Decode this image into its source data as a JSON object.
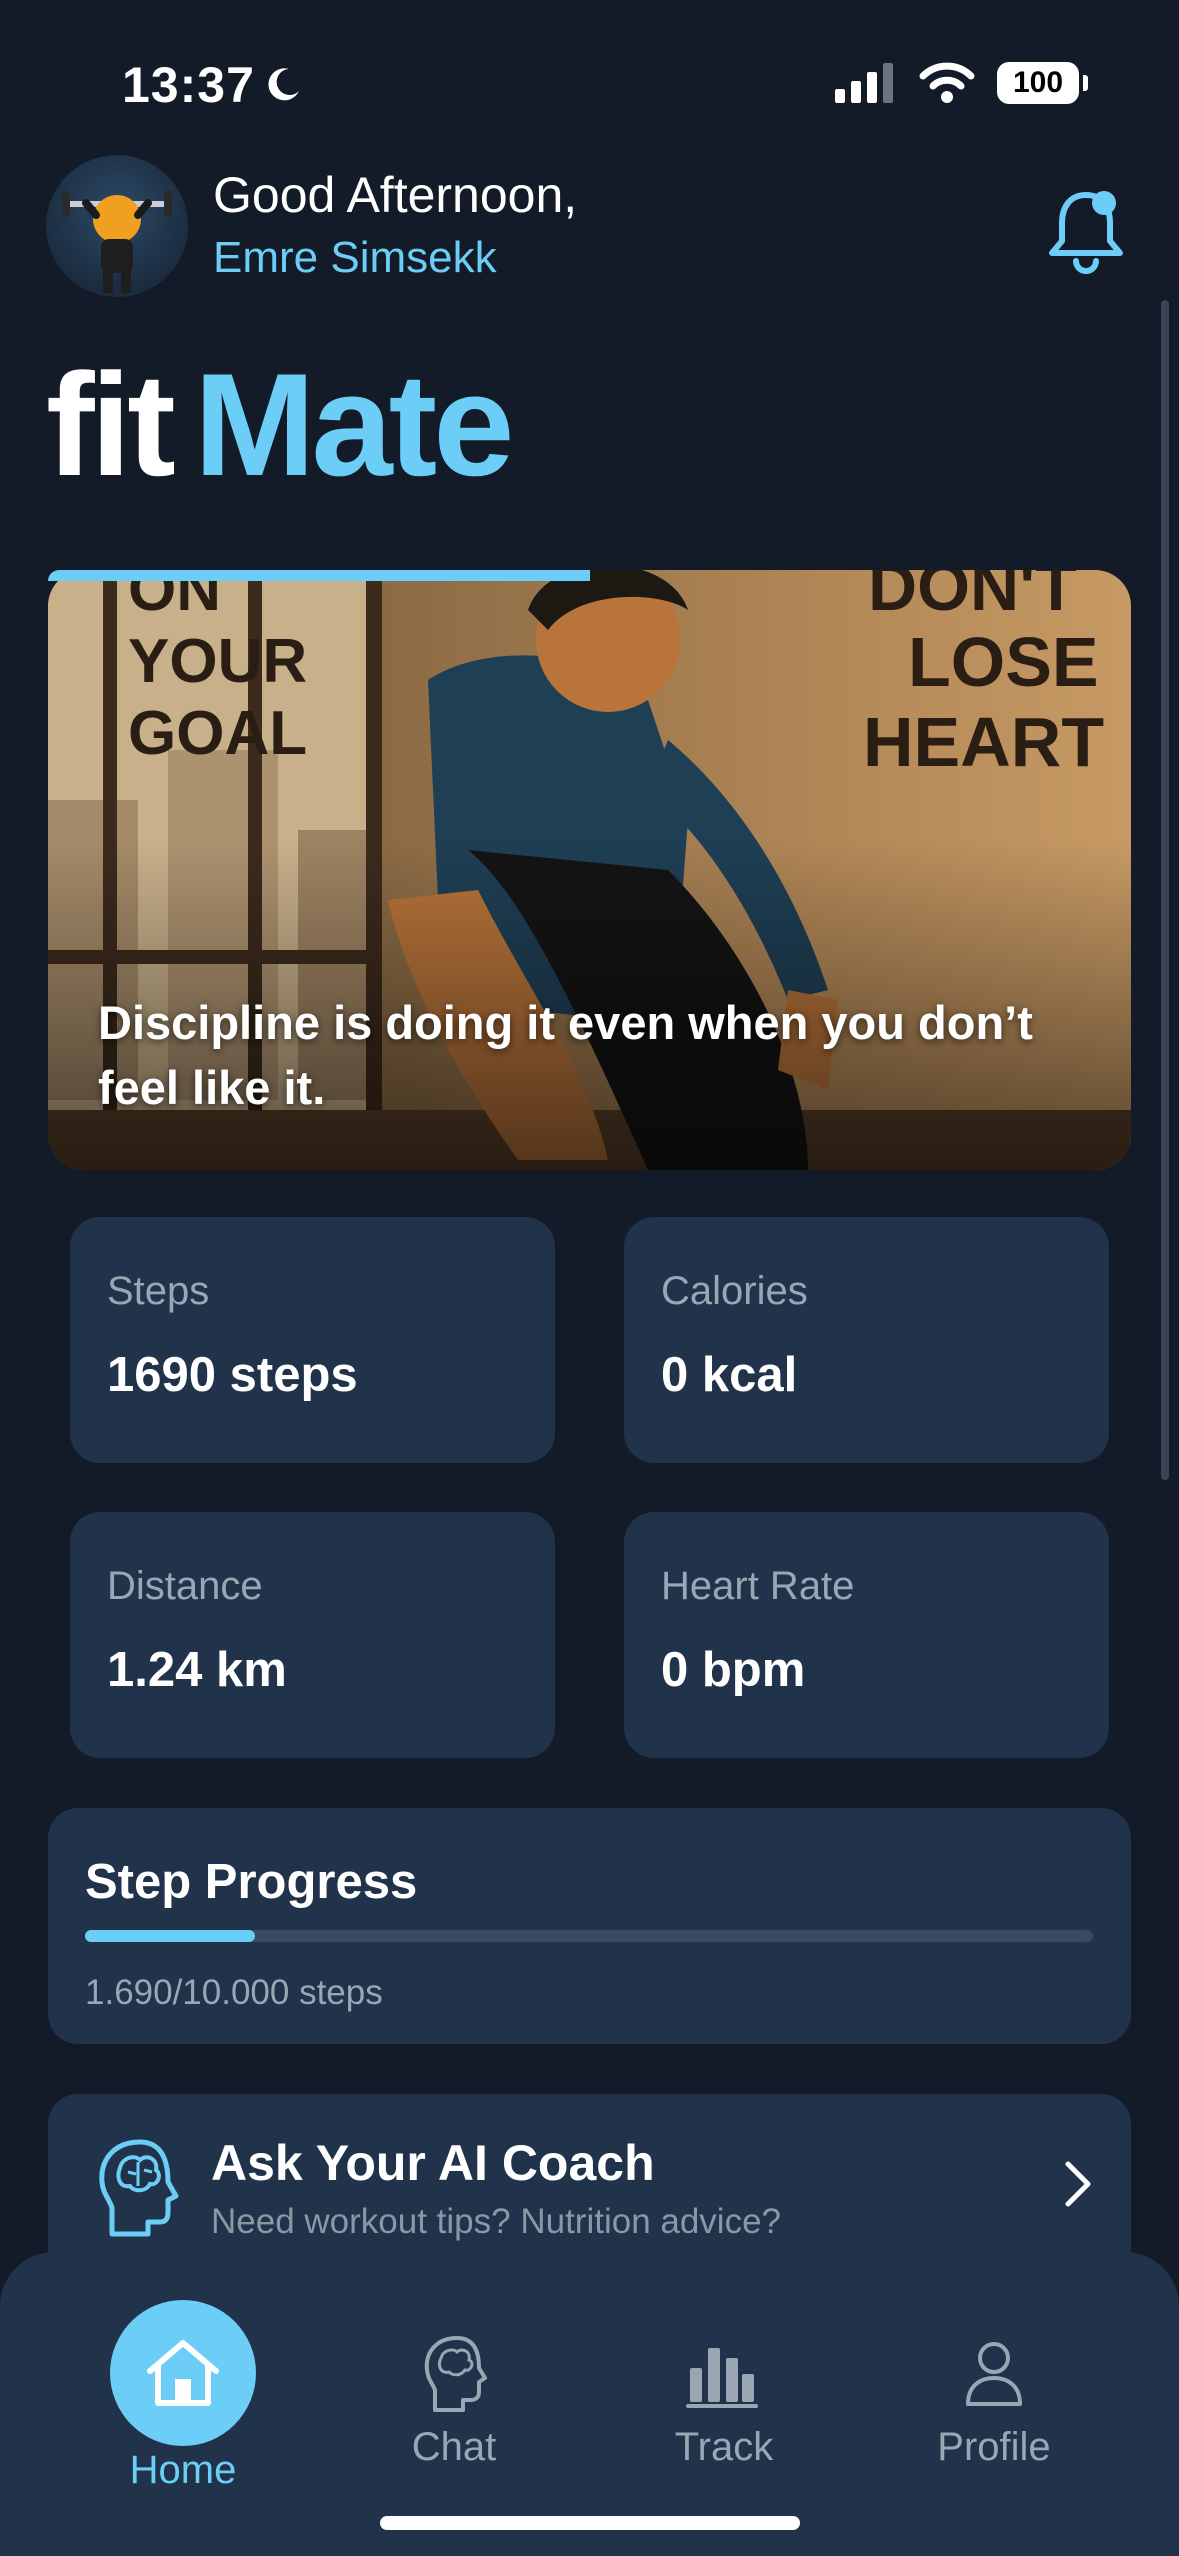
{
  "status_bar": {
    "time": "13:37",
    "battery": "100"
  },
  "header": {
    "greeting": "Good Afternoon,",
    "user_name": "Emre Simsekk"
  },
  "brand": {
    "part1": "fit",
    "part2": "Mate"
  },
  "hero": {
    "quote": "Discipline is doing it even when you don’t feel like it.",
    "poster_left": [
      "ON",
      "YOUR",
      "GOAL"
    ],
    "poster_right": [
      "DON'T",
      "LOSE",
      "HEART"
    ],
    "carousel_progress": 0.5
  },
  "stats": [
    {
      "label": "Steps",
      "value": "1690 steps"
    },
    {
      "label": "Calories",
      "value": "0 kcal"
    },
    {
      "label": "Distance",
      "value": "1.24 km"
    },
    {
      "label": "Heart Rate",
      "value": "0 bpm"
    }
  ],
  "step_progress": {
    "title": "Step Progress",
    "text": "1.690/10.000 steps",
    "fraction": 0.169
  },
  "coach": {
    "title": "Ask Your AI Coach",
    "subtitle": "Need workout tips? Nutrition advice?"
  },
  "nav": [
    {
      "label": "Home",
      "icon": "home-icon",
      "active": true
    },
    {
      "label": "Chat",
      "icon": "brain-icon",
      "active": false
    },
    {
      "label": "Track",
      "icon": "bar-chart-icon",
      "active": false
    },
    {
      "label": "Profile",
      "icon": "person-icon",
      "active": false
    }
  ],
  "colors": {
    "background": "#121b27",
    "card": "#20334a",
    "accent": "#6ccdf6",
    "muted": "#9aa6b3"
  }
}
